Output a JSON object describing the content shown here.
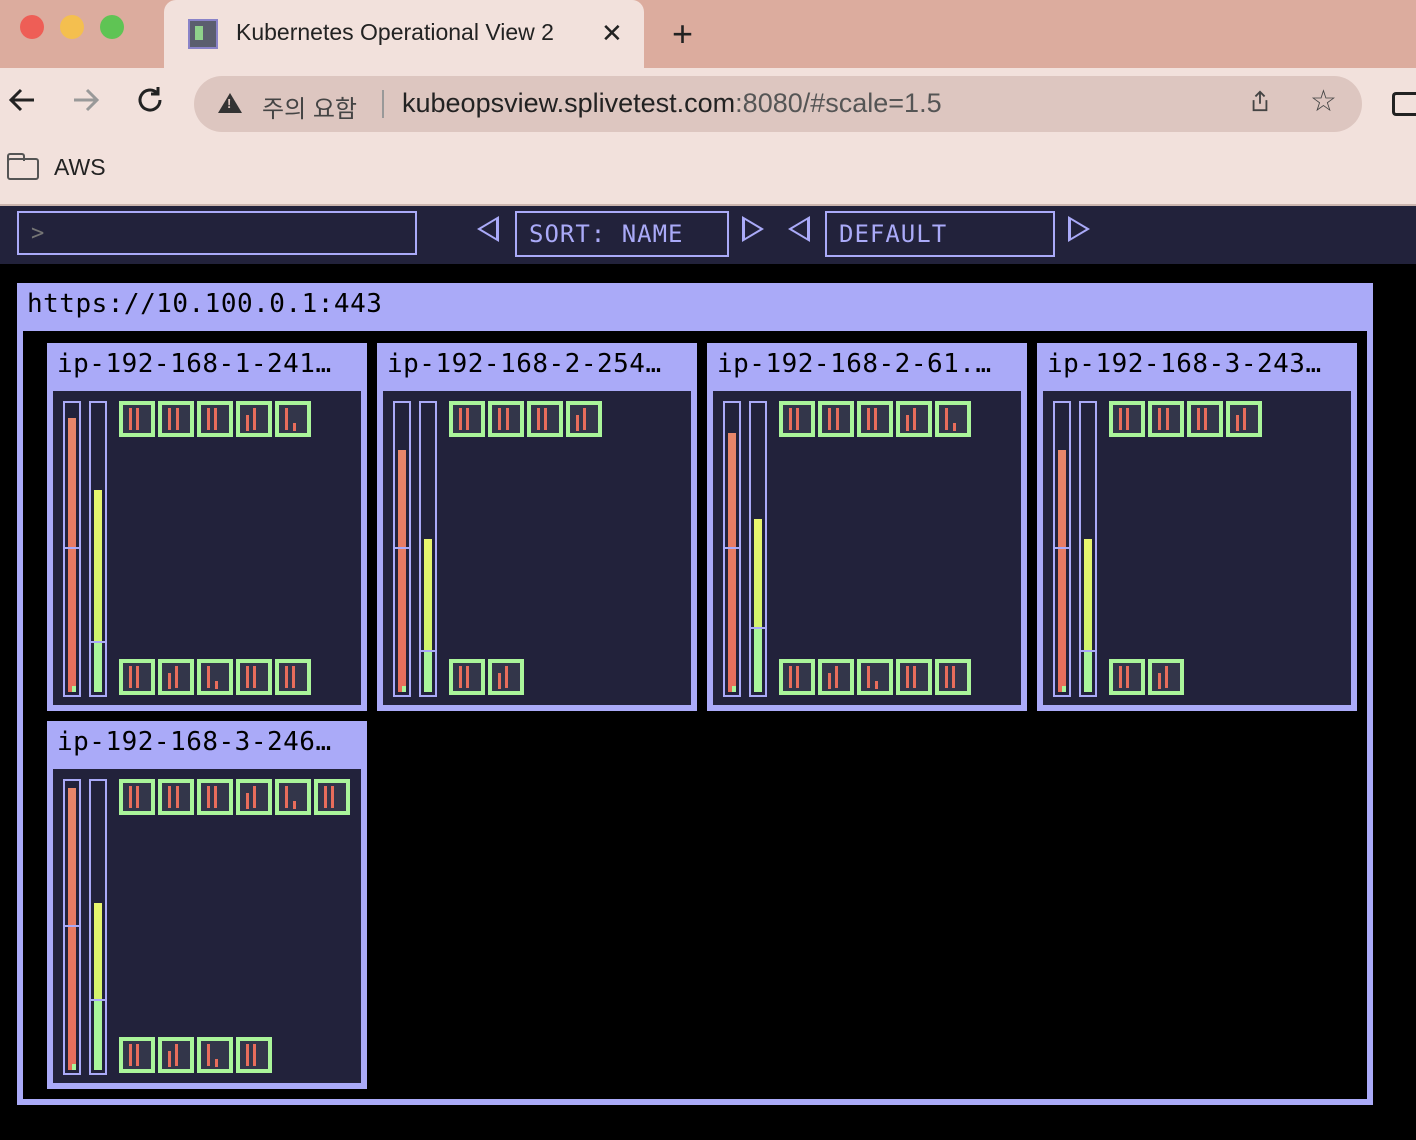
{
  "browser": {
    "tab_title": "Kubernetes Operational View 2",
    "tab_close": "✕",
    "new_tab": "+",
    "security_label": "주의 요함",
    "url_host": "kubeopsview.splivetest.com",
    "url_rest": ":8080/#scale=1.5",
    "bookmark": "AWS",
    "colors": {
      "tab_strip": "#dcac9e",
      "toolbar": "#f2e1dc",
      "omnibox": "#ddc6c0"
    }
  },
  "app": {
    "filter_placeholder": ">",
    "sort_label": "SORT: NAME",
    "theme_label": "DEFAULT",
    "colors": {
      "accent": "#aaaaf8",
      "panel": "#22223b",
      "pod_border": "#aaf59a",
      "cpu": "#e8866a",
      "memory": "#e8f56e"
    }
  },
  "cluster": {
    "title": "https://10.100.0.1:443",
    "nodes": [
      {
        "name": "ip-192-168-1-241…",
        "top_pods": 5,
        "bottom_pods": 5,
        "cpu_usage": 0.95,
        "mem_usage": 0.7,
        "mem_requested": 0.17
      },
      {
        "name": "ip-192-168-2-254…",
        "top_pods": 4,
        "bottom_pods": 2,
        "cpu_usage": 0.84,
        "mem_usage": 0.53,
        "mem_requested": 0.14
      },
      {
        "name": "ip-192-168-2-61.…",
        "top_pods": 5,
        "bottom_pods": 5,
        "cpu_usage": 0.9,
        "mem_usage": 0.6,
        "mem_requested": 0.22
      },
      {
        "name": "ip-192-168-3-243…",
        "top_pods": 4,
        "bottom_pods": 2,
        "cpu_usage": 0.84,
        "mem_usage": 0.53,
        "mem_requested": 0.14
      },
      {
        "name": "ip-192-168-3-246…",
        "top_pods": 6,
        "bottom_pods": 4,
        "cpu_usage": 0.98,
        "mem_usage": 0.58,
        "mem_requested": 0.24
      }
    ]
  }
}
